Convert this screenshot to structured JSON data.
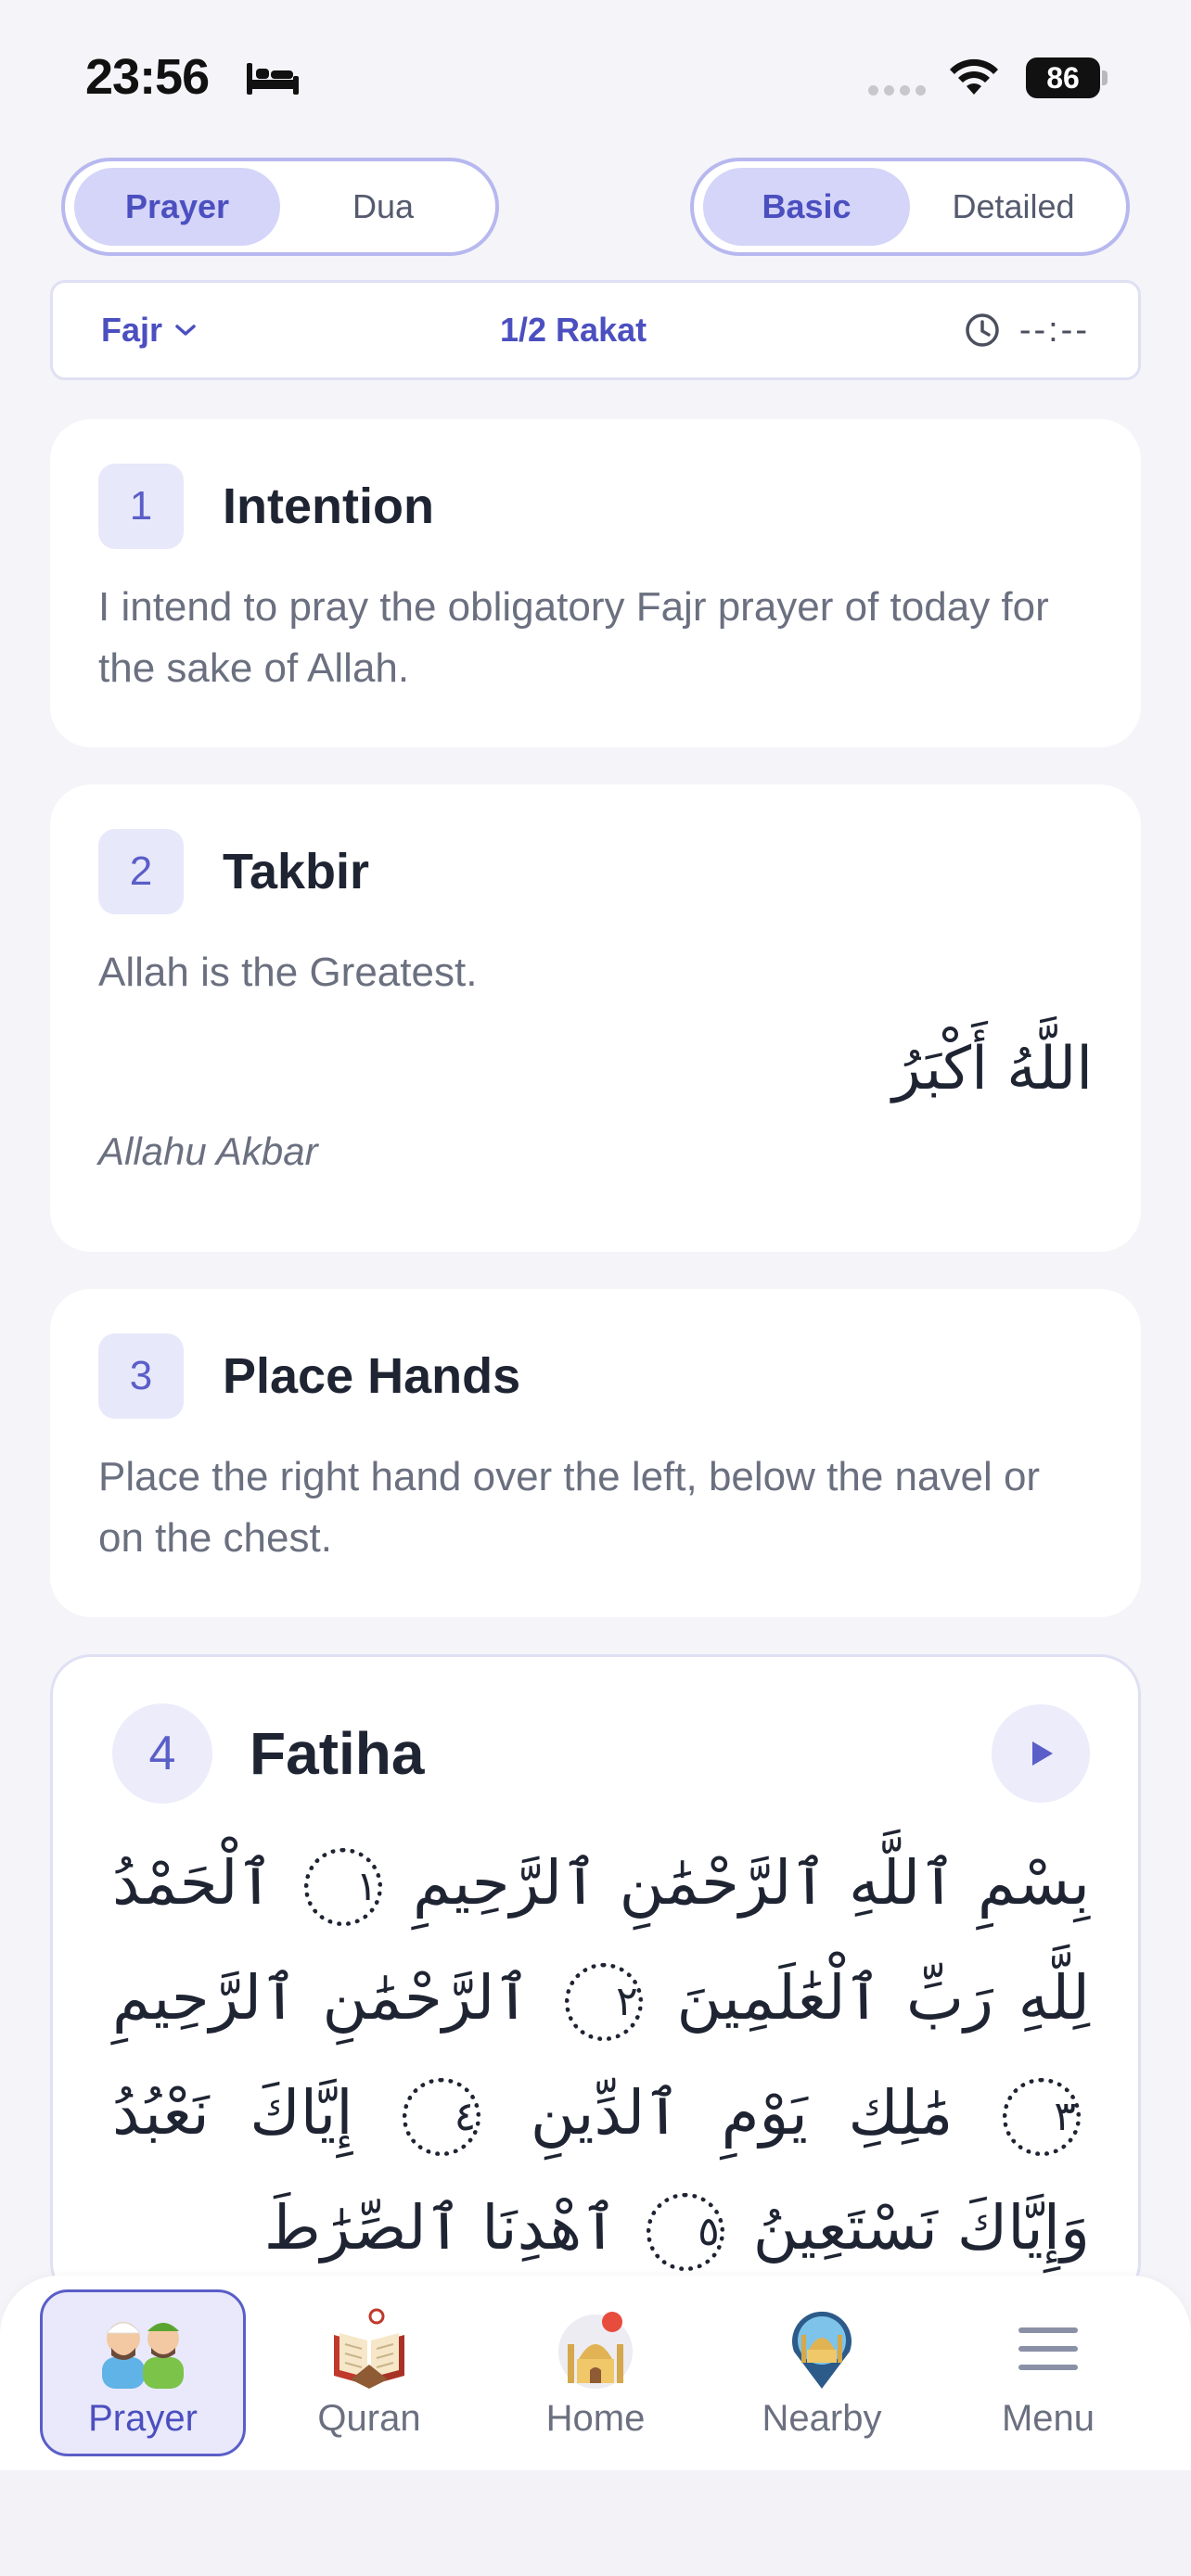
{
  "status_bar": {
    "time": "23:56",
    "battery": "86"
  },
  "toggles": {
    "mode": {
      "options": [
        "Prayer",
        "Dua"
      ],
      "selected": "Prayer"
    },
    "detail": {
      "options": [
        "Basic",
        "Detailed"
      ],
      "selected": "Basic"
    }
  },
  "info_bar": {
    "prayer": "Fajr",
    "rakat": "1/2 Rakat",
    "timer": "--:--"
  },
  "steps": [
    {
      "number": "1",
      "title": "Intention",
      "description": "I intend to pray the obligatory Fajr prayer of today for the sake of Allah."
    },
    {
      "number": "2",
      "title": "Takbir",
      "description": "Allah is the Greatest.",
      "arabic": "اللَّهُ أَكْبَرُ",
      "transliteration": "Allahu Akbar"
    },
    {
      "number": "3",
      "title": "Place Hands",
      "description": "Place the right hand over the left, below the navel or on the chest."
    },
    {
      "number": "4",
      "title": "Fatiha",
      "verses": [
        {
          "text": "بِسْمِ ٱللَّهِ ٱلرَّحْمَٰنِ ٱلرَّحِيمِ",
          "marker": "١"
        },
        {
          "text": "ٱلْحَمْدُ لِلَّهِ رَبِّ ٱلْعَٰلَمِينَ",
          "marker": "٢"
        },
        {
          "text": "ٱلرَّحْمَٰنِ ٱلرَّحِيمِ",
          "marker": "٣"
        },
        {
          "text": "مَٰلِكِ يَوْمِ ٱلدِّينِ",
          "marker": "٤"
        },
        {
          "text": "إِيَّاكَ نَعْبُدُ وَإِيَّاكَ نَسْتَعِينُ",
          "marker": "٥"
        },
        {
          "text": "ٱهْدِنَا ٱلصِّرَٰطَ",
          "marker": ""
        }
      ]
    }
  ],
  "nav": [
    {
      "label": "Prayer",
      "icon": "prayer-people-icon",
      "active": true
    },
    {
      "label": "Quran",
      "icon": "quran-book-icon",
      "active": false
    },
    {
      "label": "Home",
      "icon": "mosque-icon",
      "active": false
    },
    {
      "label": "Nearby",
      "icon": "location-mosque-icon",
      "active": false
    },
    {
      "label": "Menu",
      "icon": "hamburger-icon",
      "active": false
    }
  ],
  "colors": {
    "accent": "#4b4fbf",
    "accent_light": "#d4d5f8",
    "border": "#b7b8ef",
    "background": "#f4f4f9"
  }
}
